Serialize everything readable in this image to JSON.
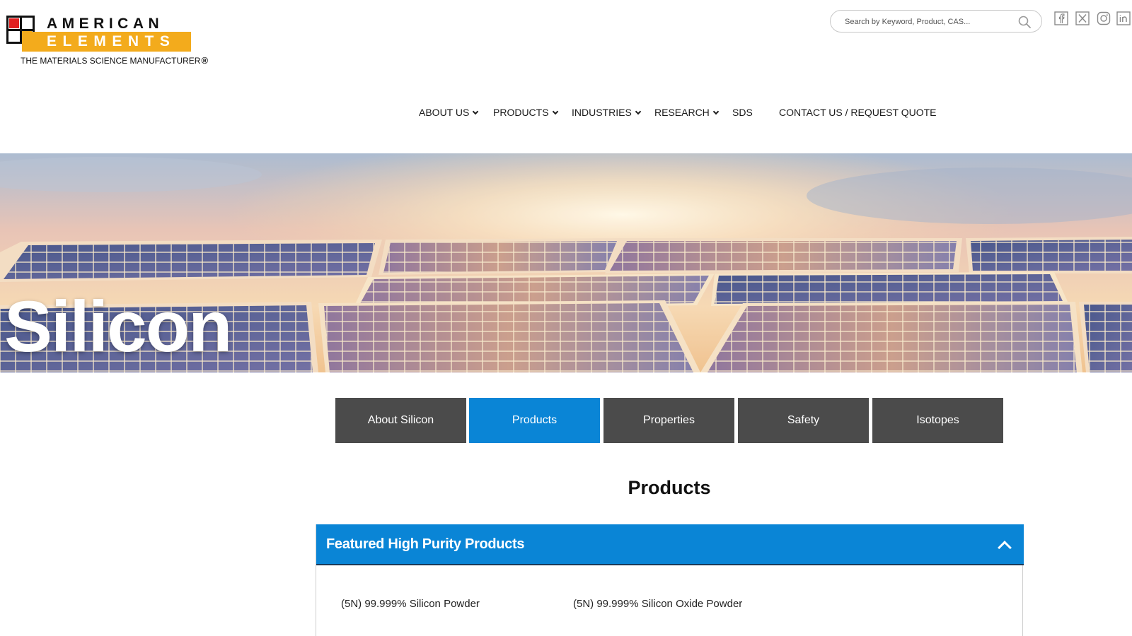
{
  "brand": {
    "line1": "AMERICAN",
    "line2": "ELEMENTS",
    "tagline": "THE MATERIALS SCIENCE MANUFACTURER",
    "registered": "®",
    "colors": {
      "gold": "#f3ab1c",
      "red": "#e02020",
      "dark": "#111111"
    }
  },
  "search": {
    "placeholder": "Search by Keyword, Product, CAS...",
    "icon": "search-icon"
  },
  "social": [
    {
      "name": "facebook",
      "icon": "facebook-icon"
    },
    {
      "name": "x",
      "icon": "x-icon"
    },
    {
      "name": "instagram",
      "icon": "instagram-icon"
    },
    {
      "name": "linkedin",
      "icon": "linkedin-icon"
    }
  ],
  "nav": {
    "items": [
      {
        "label": "ABOUT US",
        "dropdown": true
      },
      {
        "label": "PRODUCTS",
        "dropdown": true
      },
      {
        "label": "INDUSTRIES",
        "dropdown": true
      },
      {
        "label": "RESEARCH",
        "dropdown": true
      },
      {
        "label": "SDS",
        "dropdown": false
      },
      {
        "label": "CONTACT US / REQUEST QUOTE",
        "dropdown": false
      }
    ]
  },
  "hero": {
    "title": "Silicon"
  },
  "tabs": [
    {
      "label": "About Silicon",
      "active": false
    },
    {
      "label": "Products",
      "active": true
    },
    {
      "label": "Properties",
      "active": false
    },
    {
      "label": "Safety",
      "active": false
    },
    {
      "label": "Isotopes",
      "active": false
    }
  ],
  "section": {
    "title": "Products"
  },
  "accordion": {
    "title": "Featured High Purity Products",
    "expanded": true,
    "products": [
      "(5N) 99.999% Silicon Powder",
      "(5N) 99.999% Silicon Oxide Powder"
    ]
  },
  "colors": {
    "accent": "#0a85d6",
    "tab_inactive": "#4b4b4b"
  }
}
